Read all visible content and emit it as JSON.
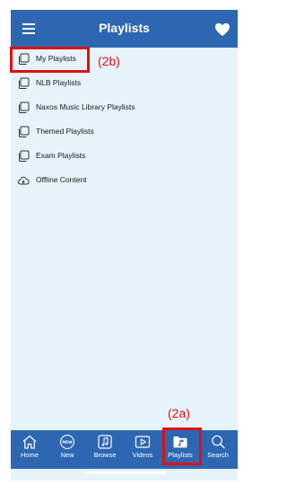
{
  "header": {
    "title": "Playlists",
    "menu_icon": "hamburger-icon",
    "favorites_icon": "heart-icon"
  },
  "playlists": [
    {
      "label": "My Playlists",
      "icon": "playlist-stack-icon"
    },
    {
      "label": "NLB Playlists",
      "icon": "playlist-stack-icon"
    },
    {
      "label": "Naxos Music Library Playlists",
      "icon": "playlist-stack-icon"
    },
    {
      "label": "Themed Playlists",
      "icon": "playlist-stack-icon"
    },
    {
      "label": "Exam Playlists",
      "icon": "playlist-stack-icon"
    },
    {
      "label": "Offline Content",
      "icon": "cloud-download-icon"
    }
  ],
  "annotations": {
    "item_callout": "(2b)",
    "tab_callout": "(2a)",
    "color": "#e01010"
  },
  "tabs": [
    {
      "label": "Home",
      "icon": "home-icon"
    },
    {
      "label": "New",
      "icon": "new-badge-icon"
    },
    {
      "label": "Browse",
      "icon": "music-note-book-icon"
    },
    {
      "label": "Videos",
      "icon": "play-icon"
    },
    {
      "label": "Playlists",
      "icon": "music-folder-icon",
      "active": true
    },
    {
      "label": "Search",
      "icon": "search-icon"
    }
  ],
  "colors": {
    "brand": "#2d67b2",
    "background": "#e6f3fb"
  }
}
